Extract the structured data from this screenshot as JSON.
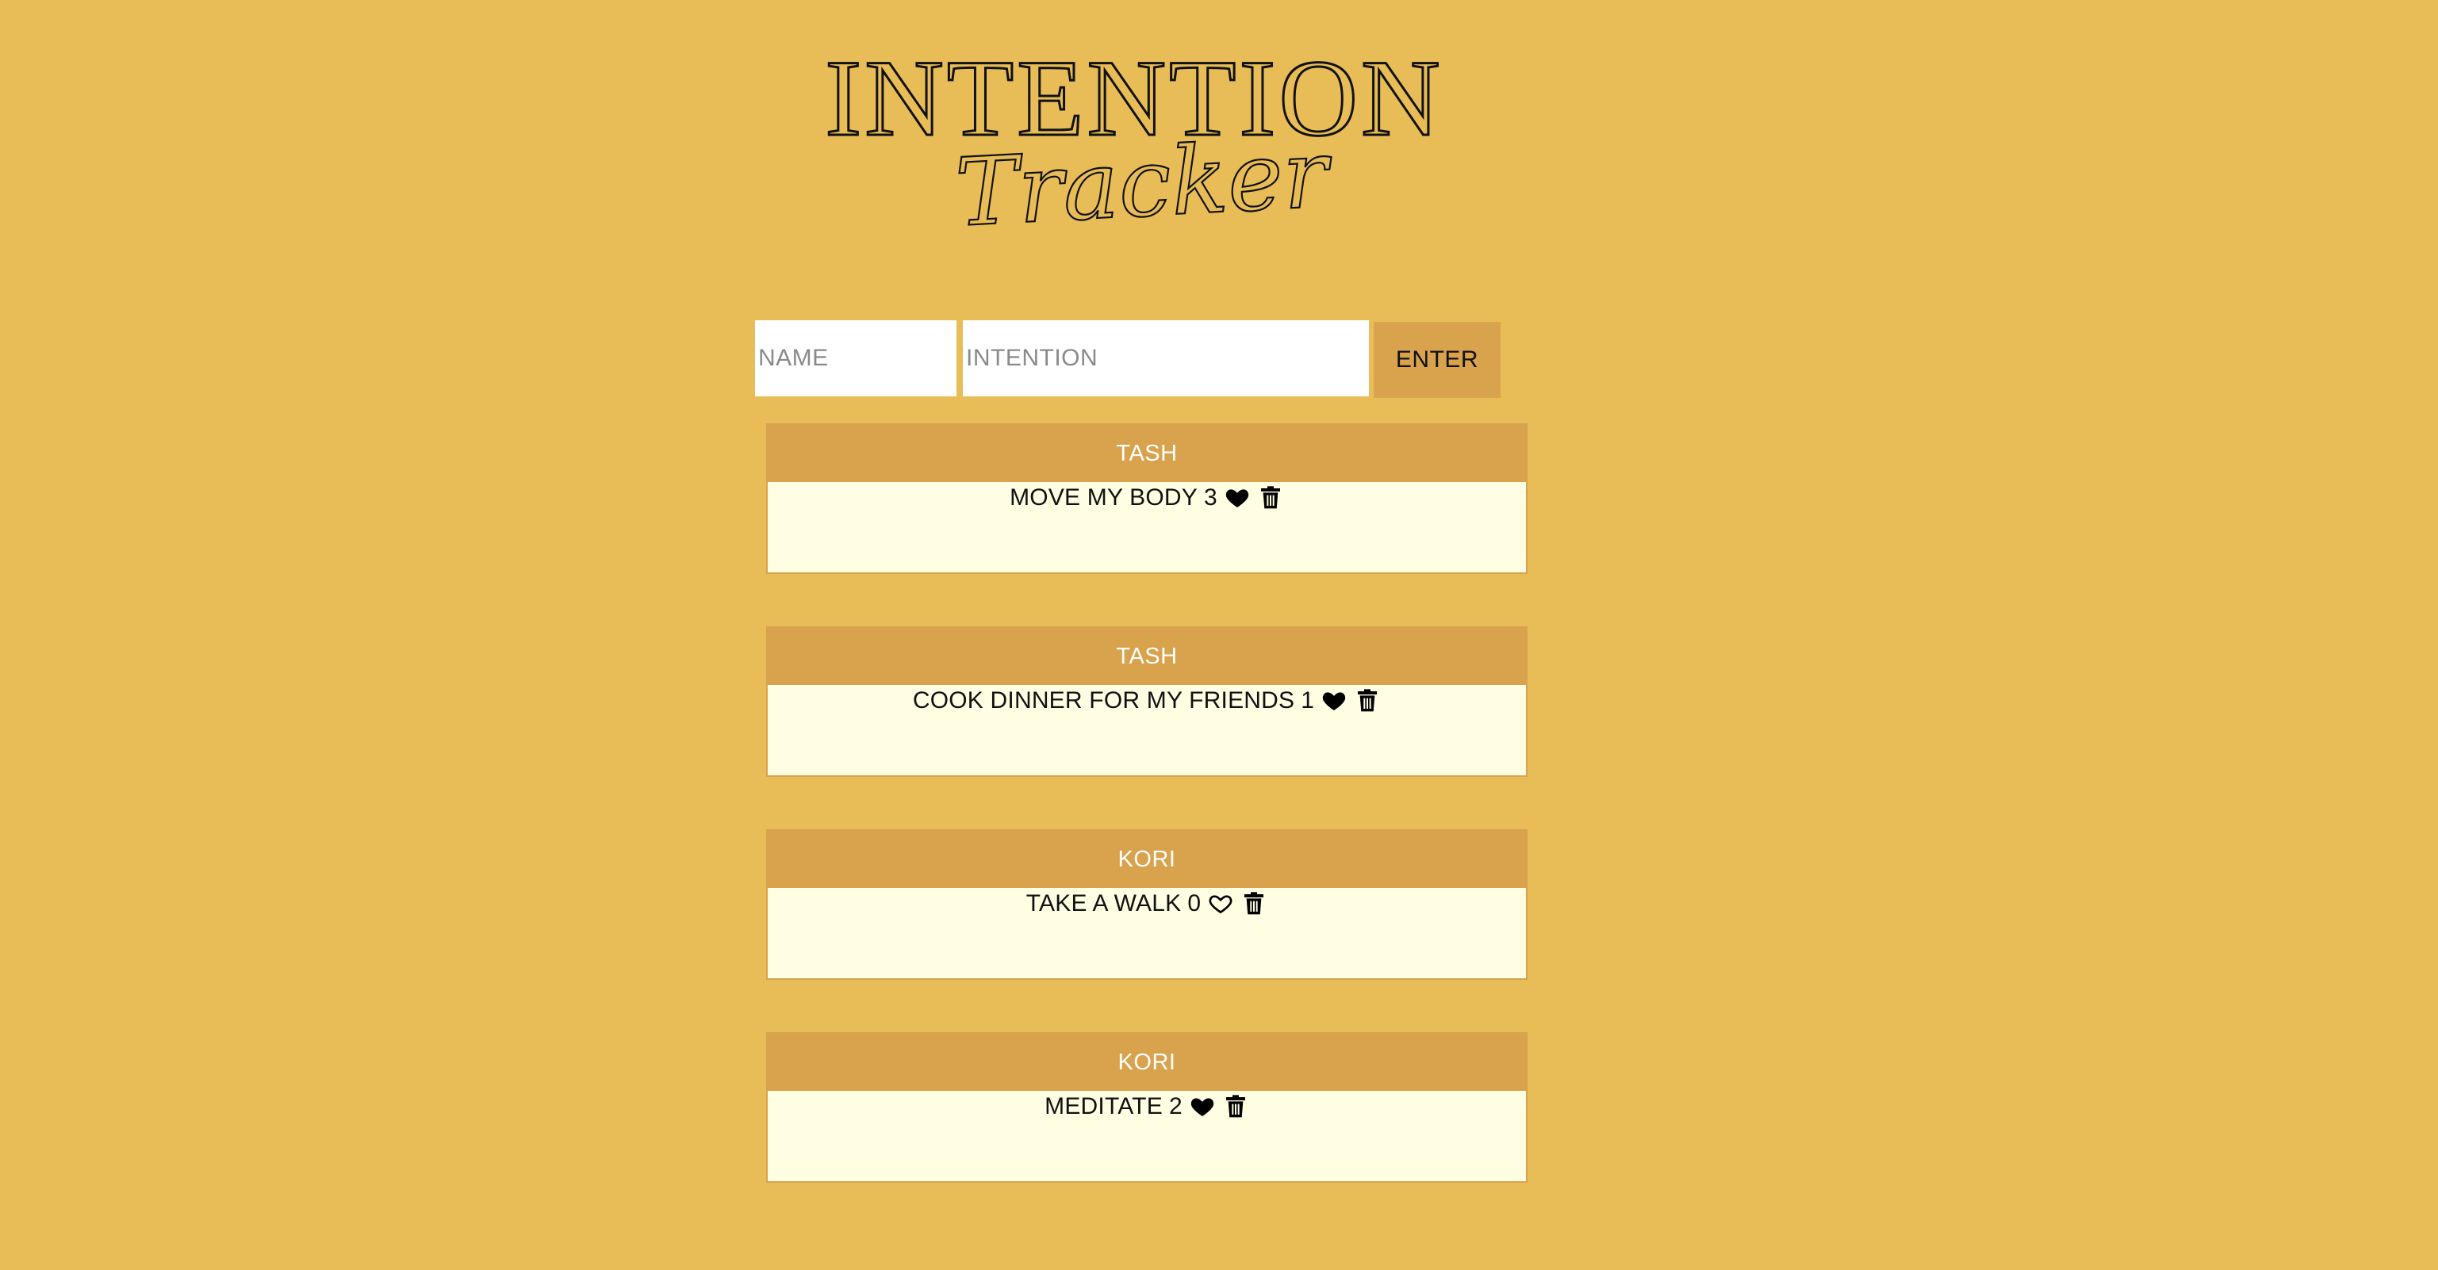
{
  "header": {
    "title_main": "INTENTION",
    "title_script": "Tracker"
  },
  "form": {
    "name_placeholder": "NAME",
    "intention_placeholder": "INTENTION",
    "enter_label": "ENTER"
  },
  "cards": [
    {
      "name": "TASH",
      "intention": "MOVE MY BODY",
      "likes": "3",
      "liked": true
    },
    {
      "name": "TASH",
      "intention": "COOK DINNER FOR MY FRIENDS",
      "likes": "1",
      "liked": true
    },
    {
      "name": "KORI",
      "intention": "TAKE A WALK",
      "likes": "0",
      "liked": false
    },
    {
      "name": "KORI",
      "intention": "MEDITATE",
      "likes": "2",
      "liked": true
    }
  ],
  "colors": {
    "background": "#e8bd57",
    "accent": "#d9a24c",
    "card_body": "#fffee3"
  },
  "icons": {
    "like": "heart-icon",
    "delete": "trash-icon"
  }
}
